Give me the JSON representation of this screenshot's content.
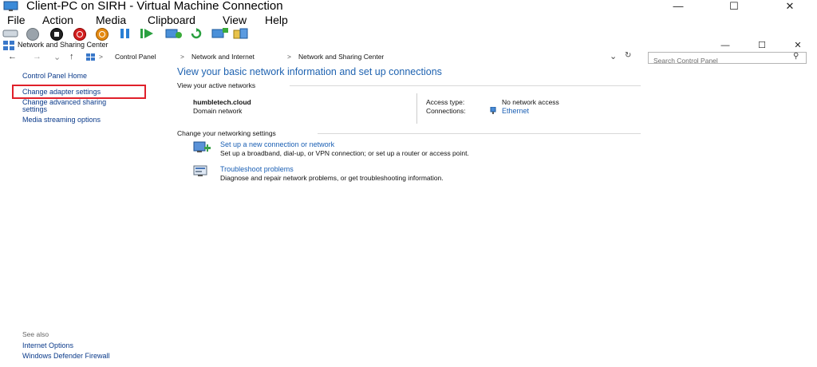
{
  "window": {
    "title": "Client-PC on SIRH - Virtual Machine Connection",
    "minimize": "—",
    "maximize": "☐",
    "close": "✕"
  },
  "menu": [
    "File",
    "Action",
    "Media",
    "Clipboard",
    "View",
    "Help"
  ],
  "toolbar_icons": [
    "ctrl-alt-del-icon",
    "start-icon",
    "turn-off-icon",
    "shutdown-icon",
    "power-icon",
    "pause-icon",
    "resume-icon",
    "checkpoint-icon",
    "revert-icon",
    "enhanced-session-icon",
    "share-icon"
  ],
  "explorer": {
    "title": "Network and Sharing Center",
    "back": "←",
    "forward": "→",
    "recent": "⌄",
    "up": "↑",
    "path": [
      "Control Panel",
      "Network and Internet",
      "Network and Sharing Center"
    ],
    "separator": ">",
    "dropdown": "⌄",
    "refresh": "↻",
    "search_placeholder": "Search Control Panel",
    "search_icon": "⚲"
  },
  "sidebar": {
    "home": "Control Panel Home",
    "links": [
      "Change adapter settings",
      "Change advanced sharing",
      "settings",
      "Media streaming options"
    ],
    "see_also_label": "See also",
    "see_also": [
      "Internet Options",
      "Windows Defender Firewall"
    ]
  },
  "main": {
    "heading": "View your basic network information and set up connections",
    "active_networks_label": "View your active networks",
    "network_name": "humbletech.cloud",
    "network_type": "Domain network",
    "access_type_label": "Access type:",
    "access_type_value": "No network access",
    "connections_label": "Connections:",
    "connections_value": "Ethernet",
    "change_settings_label": "Change your networking settings",
    "tasks": [
      {
        "title": "Set up a new connection or network",
        "desc": "Set up a broadband, dial-up, or VPN connection; or set up a router or access point."
      },
      {
        "title": "Troubleshoot problems",
        "desc": "Diagnose and repair network problems, or get troubleshooting information."
      }
    ]
  },
  "colors": {
    "link": "#1a5fb4",
    "heading": "#1e62b0",
    "highlight": "#e0202a"
  }
}
